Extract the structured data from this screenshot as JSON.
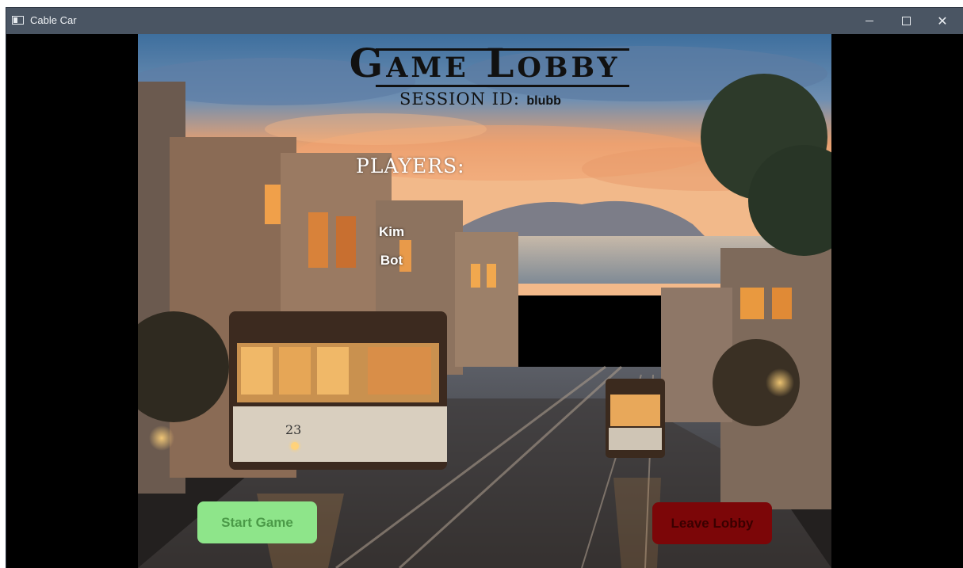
{
  "window": {
    "title": "Cable Car",
    "controls": {
      "minimize": "minimize-icon",
      "maximize": "maximize-icon",
      "close": "close-icon"
    }
  },
  "lobby": {
    "title": "Game Lobby",
    "session_label": "SESSION ID:",
    "session_id": "blubb",
    "players_heading": "PLAYERS:",
    "players": [
      "Kim",
      "Bot"
    ]
  },
  "buttons": {
    "start_label": "Start Game",
    "leave_label": "Leave Lobby"
  },
  "colors": {
    "titlebar": "#4a5563",
    "start_button": "#8ee58a",
    "start_text": "#4b9a48",
    "leave_button": "#7c0608",
    "leave_text": "#3a0000"
  }
}
